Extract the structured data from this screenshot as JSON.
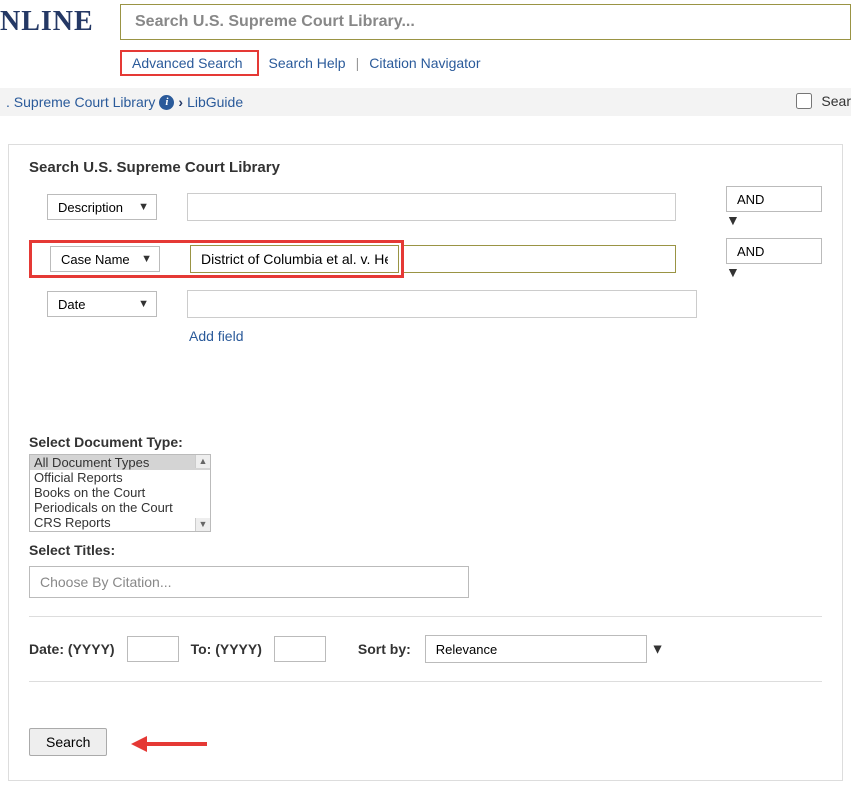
{
  "brand": "NLINE",
  "searchbar_placeholder": "Search U.S. Supreme Court Library...",
  "sublinks": {
    "advanced": "Advanced Search",
    "help": "Search Help",
    "citation": "Citation Navigator"
  },
  "search_checkbox_label": "Sear",
  "breadcrumb": {
    "lib": ". Supreme Court Library",
    "guide": "LibGuide"
  },
  "panel_title": "Search U.S. Supreme Court Library",
  "rows": [
    {
      "field": "Description",
      "value": "",
      "op": "AND"
    },
    {
      "field": "Case Name",
      "value": "District of Columbia et al. v. Heller",
      "op": "AND"
    },
    {
      "field": "Date",
      "value": "",
      "op": null
    }
  ],
  "add_field_label": "Add field",
  "section_doc_type": "Select Document Type:",
  "doc_types": [
    "All Document Types",
    "Official Reports",
    "Books on the Court",
    "Periodicals on the Court",
    "CRS Reports"
  ],
  "doc_types_selected": "All Document Types",
  "section_titles": "Select Titles:",
  "titles_placeholder": "Choose By Citation...",
  "date_label_from": "Date: (YYYY)",
  "date_label_to": "To: (YYYY)",
  "sort_label": "Sort by:",
  "sort_value": "Relevance",
  "search_button": "Search"
}
